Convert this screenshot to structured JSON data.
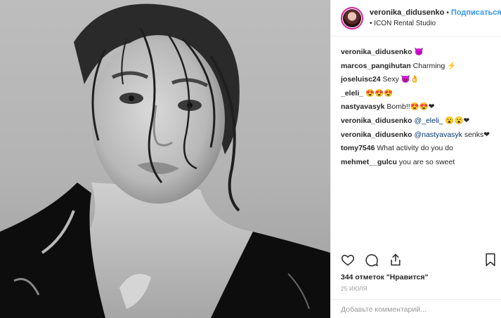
{
  "post": {
    "username": "veronika_didusenko",
    "separator": "•",
    "follow_label": "Подписаться",
    "location": "ICON Rental Studio",
    "location_prefix": "•"
  },
  "comments": [
    {
      "user": "veronika_didusenko",
      "text": " 😈"
    },
    {
      "user": "marcos_pangihutan",
      "text": " Charming ⚡"
    },
    {
      "user": "joseluisc24",
      "text": " Sexy 😈👌"
    },
    {
      "user": "_eleli_",
      "text": " 😍😍😍"
    },
    {
      "user": "nastyavasyk",
      "text": " Bomb!!😍😍❤"
    },
    {
      "user": "veronika_didusenko",
      "mention": "@_eleli_",
      "text": " 😮😮❤"
    },
    {
      "user": "veronika_didusenko",
      "mention": "@nastyavasyk",
      "text": " senks❤"
    },
    {
      "user": "tomy7546",
      "text": " What activity do you do"
    },
    {
      "user": "mehmet__gulcu",
      "text": " you are so sweet"
    }
  ],
  "footer": {
    "likes": "344 отметок \"Нравится\"",
    "date": "25 ИЮЛЯ",
    "add_comment_placeholder": "Добавьте комментарий..."
  },
  "icons": {
    "like": "heart-icon",
    "comment": "comment-icon",
    "share": "share-icon",
    "save": "bookmark-icon"
  }
}
